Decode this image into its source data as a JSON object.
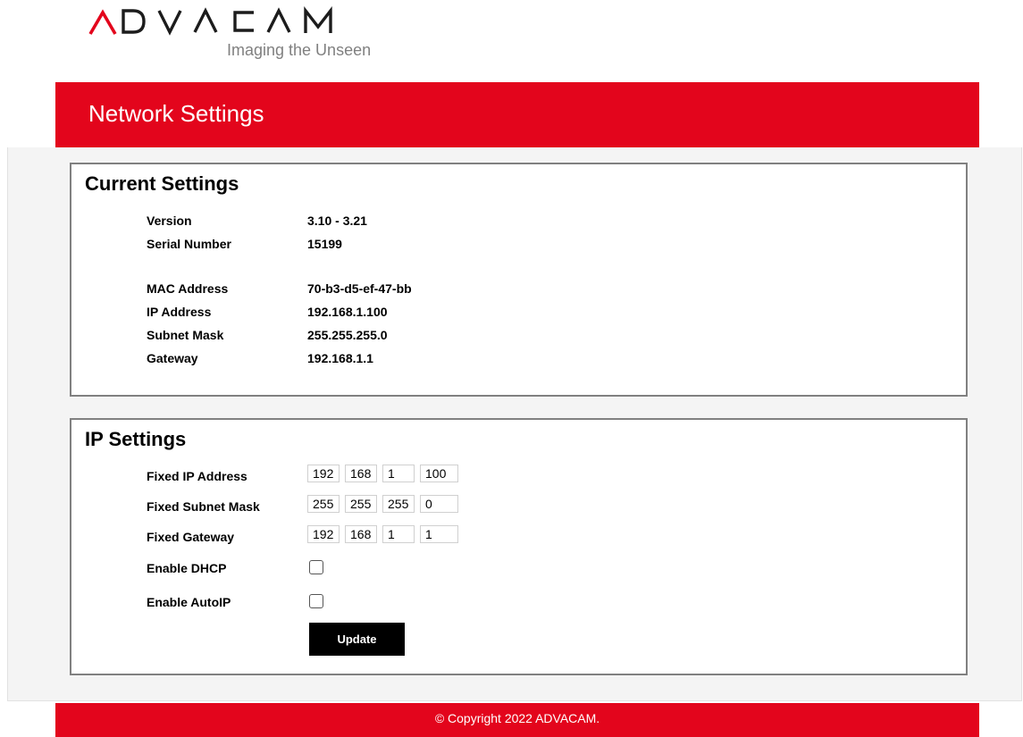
{
  "brand": {
    "logo_text": "ADVACAM",
    "tagline": "Imaging the Unseen",
    "accent_color": "#e3051c"
  },
  "header": {
    "title": "Network Settings"
  },
  "current_settings": {
    "title": "Current Settings",
    "rows": [
      {
        "label": "Version",
        "value": "3.10 - 3.21"
      },
      {
        "label": "Serial Number",
        "value": "15199"
      },
      {
        "label": "MAC Address",
        "value": "70-b3-d5-ef-47-bb"
      },
      {
        "label": "IP Address",
        "value": "192.168.1.100"
      },
      {
        "label": "Subnet Mask",
        "value": "255.255.255.0"
      },
      {
        "label": "Gateway",
        "value": "192.168.1.1"
      }
    ]
  },
  "ip_settings": {
    "title": "IP Settings",
    "fixed_ip": {
      "label": "Fixed IP Address",
      "octets": [
        "192",
        "168",
        "1",
        "100"
      ]
    },
    "fixed_subnet": {
      "label": "Fixed Subnet Mask",
      "octets": [
        "255",
        "255",
        "255",
        "0"
      ]
    },
    "fixed_gateway": {
      "label": "Fixed Gateway",
      "octets": [
        "192",
        "168",
        "1",
        "1"
      ]
    },
    "dhcp": {
      "label": "Enable DHCP",
      "checked": false
    },
    "autoip": {
      "label": "Enable AutoIP",
      "checked": false
    },
    "update_label": "Update"
  },
  "footer": {
    "copyright": "© Copyright 2022 ADVACAM."
  }
}
